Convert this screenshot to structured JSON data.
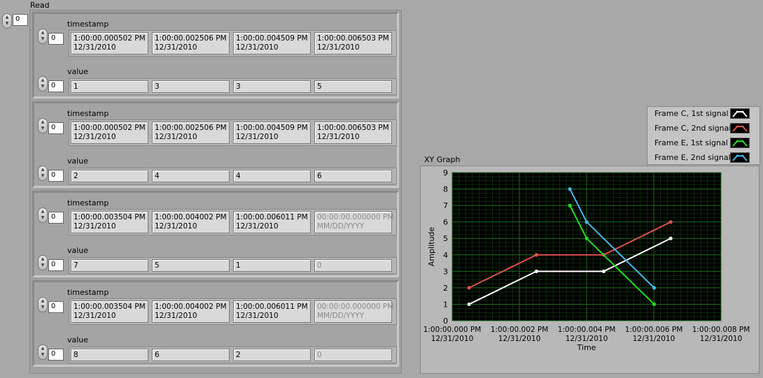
{
  "read": {
    "label": "Read",
    "index": "0",
    "elements": [
      {
        "timestamp_label": "timestamp",
        "timestamp_index": "0",
        "timestamps": [
          {
            "time": "1:00:00.000502 PM",
            "date": "12/31/2010",
            "dim": false
          },
          {
            "time": "1:00:00.002506 PM",
            "date": "12/31/2010",
            "dim": false
          },
          {
            "time": "1:00:00.004509 PM",
            "date": "12/31/2010",
            "dim": false
          },
          {
            "time": "1:00:00.006503 PM",
            "date": "12/31/2010",
            "dim": false
          }
        ],
        "value_label": "value",
        "value_index": "0",
        "values": [
          {
            "v": "1",
            "dim": false
          },
          {
            "v": "3",
            "dim": false
          },
          {
            "v": "3",
            "dim": false
          },
          {
            "v": "5",
            "dim": false
          }
        ]
      },
      {
        "timestamp_label": "timestamp",
        "timestamp_index": "0",
        "timestamps": [
          {
            "time": "1:00:00.000502 PM",
            "date": "12/31/2010",
            "dim": false
          },
          {
            "time": "1:00:00.002506 PM",
            "date": "12/31/2010",
            "dim": false
          },
          {
            "time": "1:00:00.004509 PM",
            "date": "12/31/2010",
            "dim": false
          },
          {
            "time": "1:00:00.006503 PM",
            "date": "12/31/2010",
            "dim": false
          }
        ],
        "value_label": "value",
        "value_index": "0",
        "values": [
          {
            "v": "2",
            "dim": false
          },
          {
            "v": "4",
            "dim": false
          },
          {
            "v": "4",
            "dim": false
          },
          {
            "v": "6",
            "dim": false
          }
        ]
      },
      {
        "timestamp_label": "timestamp",
        "timestamp_index": "0",
        "timestamps": [
          {
            "time": "1:00:00.003504 PM",
            "date": "12/31/2010",
            "dim": false
          },
          {
            "time": "1:00:00.004002 PM",
            "date": "12/31/2010",
            "dim": false
          },
          {
            "time": "1:00:00.006011 PM",
            "date": "12/31/2010",
            "dim": false
          },
          {
            "time": "00:00:00.000000 PM",
            "date": "MM/DD/YYYY",
            "dim": true
          }
        ],
        "value_label": "value",
        "value_index": "0",
        "values": [
          {
            "v": "7",
            "dim": false
          },
          {
            "v": "5",
            "dim": false
          },
          {
            "v": "1",
            "dim": false
          },
          {
            "v": "0",
            "dim": true
          }
        ]
      },
      {
        "timestamp_label": "timestamp",
        "timestamp_index": "0",
        "timestamps": [
          {
            "time": "1:00:00.003504 PM",
            "date": "12/31/2010",
            "dim": false
          },
          {
            "time": "1:00:00.004002 PM",
            "date": "12/31/2010",
            "dim": false
          },
          {
            "time": "1:00:00.006011 PM",
            "date": "12/31/2010",
            "dim": false
          },
          {
            "time": "00:00:00.000000 PM",
            "date": "MM/DD/YYYY",
            "dim": true
          }
        ],
        "value_label": "value",
        "value_index": "0",
        "values": [
          {
            "v": "8",
            "dim": false
          },
          {
            "v": "6",
            "dim": false
          },
          {
            "v": "2",
            "dim": false
          },
          {
            "v": "0",
            "dim": true
          }
        ]
      }
    ]
  },
  "legend": {
    "entries": [
      {
        "name": "Frame C, 1st signal",
        "color": "#ffffff"
      },
      {
        "name": "Frame C, 2nd signal",
        "color": "#e05050"
      },
      {
        "name": "Frame E, 1st signal",
        "color": "#22dd22"
      },
      {
        "name": "Frame E, 2nd signal",
        "color": "#4ab8ee"
      }
    ]
  },
  "chart_data": {
    "type": "line",
    "title": "XY Graph",
    "xlabel": "Time",
    "ylabel": "Amplitude",
    "ylim": [
      0,
      9
    ],
    "xlim_ms": [
      0.0,
      8.0
    ],
    "grid": true,
    "plot_background": "#000000",
    "grid_color": "#1f6b1f",
    "x_ticks": [
      {
        "ms": 0.0,
        "time": "1:00:00.000 PM",
        "date": "12/31/2010"
      },
      {
        "ms": 2.0,
        "time": "1:00:00.002 PM",
        "date": "12/31/2010"
      },
      {
        "ms": 4.0,
        "time": "1:00:00.004 PM",
        "date": "12/31/2010"
      },
      {
        "ms": 6.0,
        "time": "1:00:00.006 PM",
        "date": "12/31/2010"
      },
      {
        "ms": 8.0,
        "time": "1:00:00.008 PM",
        "date": "12/31/2010"
      }
    ],
    "y_ticks": [
      0,
      1,
      2,
      3,
      4,
      5,
      6,
      7,
      8,
      9
    ],
    "series": [
      {
        "name": "Frame C, 1st signal",
        "color": "#ffffff",
        "x_ms": [
          0.502,
          2.506,
          4.509,
          6.503
        ],
        "y": [
          1,
          3,
          3,
          5
        ]
      },
      {
        "name": "Frame C, 2nd signal",
        "color": "#e05050",
        "x_ms": [
          0.502,
          2.506,
          4.509,
          6.503
        ],
        "y": [
          2,
          4,
          4,
          6
        ]
      },
      {
        "name": "Frame E, 1st signal",
        "color": "#22dd22",
        "x_ms": [
          3.504,
          4.002,
          6.011
        ],
        "y": [
          7,
          5,
          1
        ]
      },
      {
        "name": "Frame E, 2nd signal",
        "color": "#4ab8ee",
        "x_ms": [
          3.504,
          4.002,
          6.011
        ],
        "y": [
          8,
          6,
          2
        ]
      }
    ]
  }
}
